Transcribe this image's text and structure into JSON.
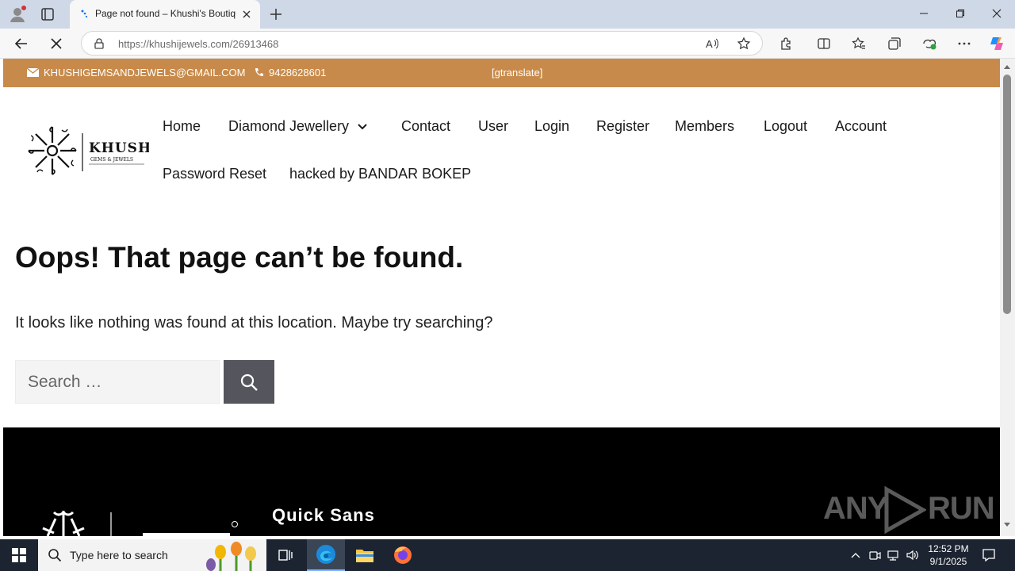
{
  "browser": {
    "tab_title": "Page not found – Khushi's Boutique",
    "url_host": "https://khushijewels.com",
    "url_path": "/26913468"
  },
  "site": {
    "topbar": {
      "email": "KHUSHIGEMSANDJEWELS@GMAIL.COM",
      "phone": "9428628601",
      "translate": "[gtranslate]"
    },
    "logo_text": "KHUSHI",
    "logo_sub": "GEMS & JEWELS",
    "nav": [
      {
        "label": "Home"
      },
      {
        "label": "Diamond Jewellery"
      },
      {
        "label": "Contact"
      },
      {
        "label": "User"
      },
      {
        "label": "Login"
      },
      {
        "label": "Register"
      },
      {
        "label": "Members"
      },
      {
        "label": "Logout"
      },
      {
        "label": "Account"
      },
      {
        "label": "Password Reset"
      },
      {
        "label": "hacked by BANDAR BOKEP"
      }
    ]
  },
  "main": {
    "title": "Oops! That page can’t be found.",
    "message": "It looks like nothing was found at this location. Maybe try searching?",
    "search_placeholder": "Search …"
  },
  "footer": {
    "heading": "Quick Sans",
    "watermark_left": "ANY",
    "watermark_right": "RUN"
  },
  "taskbar": {
    "search_placeholder": "Type here to search",
    "time": "12:52 PM",
    "date": "9/1/2025"
  },
  "colors": {
    "topbar_bg": "#c88a4a",
    "search_button": "#55555e",
    "footer_bg": "#000000"
  }
}
